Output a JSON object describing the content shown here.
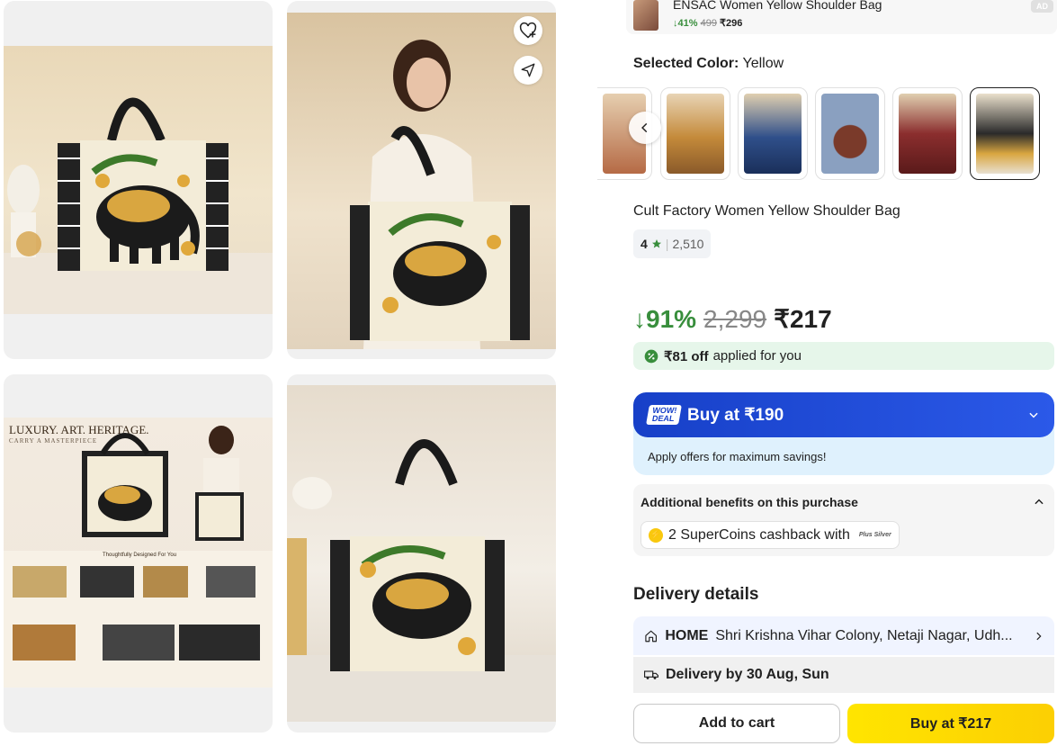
{
  "ad": {
    "title": "ENSAC Women Yellow Shoulder Bag",
    "discount": "↓41%",
    "mrp": "499",
    "price": "₹296",
    "tag": "AD"
  },
  "gallery": {
    "images": [
      "elephant-tote-on-table",
      "model-carrying-tote",
      "product-infographic",
      "tote-on-marble-table"
    ],
    "infographic_heading": "LUXURY. ART. HERITAGE.",
    "infographic_subheading": "CARRY A MASTERPIECE",
    "infographic_section": "Thoughtfully Designed For You"
  },
  "selected_color": {
    "label": "Selected Color:",
    "value": "Yellow"
  },
  "swatches": [
    {
      "name": "partial",
      "color": "#b56a45"
    },
    {
      "name": "orange-print",
      "color": "#c48a3a"
    },
    {
      "name": "blue-print",
      "color": "#2f4f8a"
    },
    {
      "name": "grey-mandala",
      "color": "#8aa0c0"
    },
    {
      "name": "red-elephant",
      "color": "#8b2e2e"
    },
    {
      "name": "yellow-elephant",
      "color": "#2a2a2a"
    }
  ],
  "product": {
    "title": "Cult Factory Women Yellow Shoulder Bag",
    "rating": "4",
    "rating_count": "2,510",
    "discount": "↓91%",
    "mrp": "2,299",
    "price": "₹217"
  },
  "offer_applied": {
    "amount": "₹81 off",
    "text": "applied for you"
  },
  "wow_deal": {
    "logo": "WOW! DEAL",
    "label": "Buy at ₹190",
    "subtext": "Apply offers for maximum savings!"
  },
  "benefits": {
    "heading": "Additional benefits on this purchase",
    "coins_text": "2 SuperCoins cashback with",
    "plus_badge": "Plus Silver"
  },
  "delivery": {
    "heading": "Delivery details",
    "address_type": "HOME",
    "address": "Shri Krishna Vihar Colony, Netaji Nagar, Udh...",
    "eta": "Delivery by 30 Aug, Sun"
  },
  "actions": {
    "add_to_cart": "Add to cart",
    "buy_now": "Buy at ₹217"
  },
  "colors": {
    "discount_green": "#388e3c",
    "wow_blue": "#1740c8",
    "buy_yellow": "#ffd814"
  }
}
